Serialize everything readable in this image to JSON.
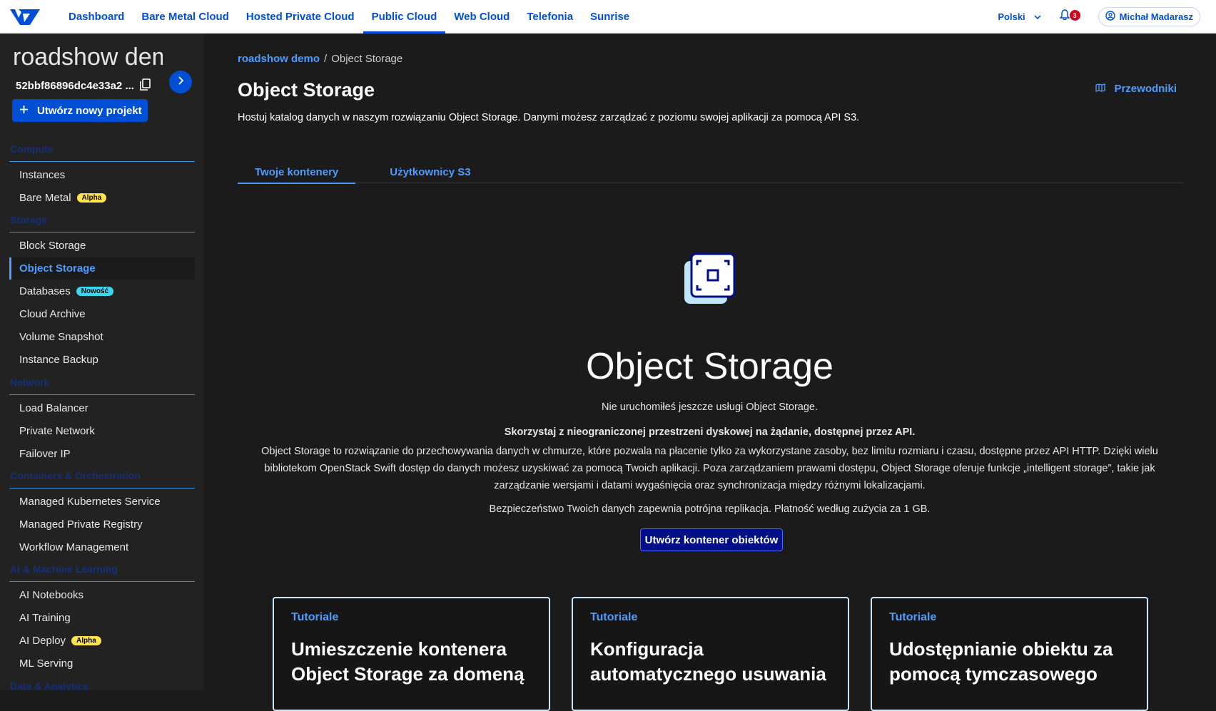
{
  "topnav": {
    "links": [
      "Dashboard",
      "Bare Metal Cloud",
      "Hosted Private Cloud",
      "Public Cloud",
      "Web Cloud",
      "Telefonia",
      "Sunrise"
    ],
    "active_index": 3,
    "language": "Polski",
    "notifications_count": "3",
    "user_name": "Michał Madarasz"
  },
  "sidebar": {
    "project_name": "roadshow demo",
    "project_id": "52bbf86896dc4e33a2 ...",
    "new_project_label": "Utwórz nowy projekt",
    "sections": [
      "Compute",
      "Storage",
      "Network",
      "Containers & Orchestration",
      "AI & Machine Learning",
      "Data & Analytics"
    ],
    "compute": [
      {
        "label": "Instances"
      },
      {
        "label": "Bare Metal",
        "tag": "Alpha"
      }
    ],
    "storage": [
      {
        "label": "Block Storage"
      },
      {
        "label": "Object Storage",
        "active": true
      },
      {
        "label": "Databases",
        "tag": "Nowość"
      },
      {
        "label": "Cloud Archive"
      },
      {
        "label": "Volume Snapshot"
      },
      {
        "label": "Instance Backup"
      }
    ],
    "network": [
      {
        "label": "Load Balancer"
      },
      {
        "label": "Private Network"
      },
      {
        "label": "Failover IP"
      }
    ],
    "containers": [
      {
        "label": "Managed Kubernetes Service"
      },
      {
        "label": "Managed Private Registry"
      },
      {
        "label": "Workflow Management"
      }
    ],
    "ai": [
      {
        "label": "AI Notebooks"
      },
      {
        "label": "AI Training"
      },
      {
        "label": "AI Deploy",
        "tag": "Alpha"
      },
      {
        "label": "ML Serving"
      }
    ]
  },
  "main": {
    "breadcrumb_root": "roadshow demo",
    "breadcrumb_sep": "/",
    "breadcrumb_current": "Object Storage",
    "title": "Object Storage",
    "guides_label": "Przewodniki",
    "description": "Hostuj katalog danych w naszym rozwiązaniu Object Storage. Danymi możesz zarządzać z poziomu swojej aplikacji za pomocą API S3.",
    "tabs": [
      "Twoje kontenery",
      "Użytkownicy S3"
    ],
    "hero_title": "Object Storage",
    "not_started": "Nie uruchomiłeś jeszcze usługi Object Storage.",
    "bold_line": "Skorzystaj z nieograniczonej przestrzeni dyskowej na żądanie, dostępnej przez API.",
    "paragraph": "Object Storage to rozwiązanie do przechowywania danych w chmurze, które pozwala na płacenie tylko za wykorzystane zasoby, bez limitu rozmiaru i czasu, dostępne przez API HTTP. Dzięki wielu bibliotekom OpenStack Swift dostęp do danych możesz uzyskiwać za pomocą Twoich aplikacji. Poza zarządzaniem prawami dostępu, Object Storage oferuje funkcje „intelligent storage”, takie jak zarządzanie wersjami i datami wygaśnięcia oraz synchronizacja między różnymi lokalizacjami.",
    "security_line": "Bezpieczeństwo Twoich danych zapewnia potrójna replikacja. Płatność według zużycia za 1 GB.",
    "cta_label": "Utwórz kontener obiektów",
    "cards": [
      {
        "category": "Tutoriale",
        "title": "Umieszczenie kontenera Object Storage za domeną"
      },
      {
        "category": "Tutoriale",
        "title": "Konfiguracja automatycznego usuwania"
      },
      {
        "category": "Tutoriale",
        "title": "Udostępnianie obiektu za pomocą tymczasowego"
      }
    ]
  },
  "colors": {
    "accent": "#0050d7",
    "link_dark": "#4d9cff",
    "cta_bg": "#000e8a",
    "alpha_tag": "#ffe44d",
    "new_tag": "#38d8ef"
  }
}
